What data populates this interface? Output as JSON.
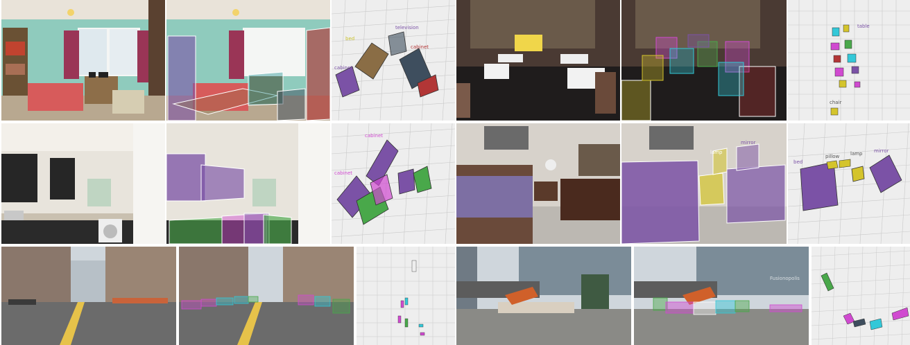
{
  "figure": {
    "rows": [
      {
        "scene": "bedroom",
        "panels": [
          "photo",
          "photo-with-3d-boxes",
          "birds-eye-view"
        ],
        "bev_labels": [
          "bed",
          "television",
          "cabinet",
          "cabinet",
          "cabinet"
        ]
      },
      {
        "scene": "restaurant",
        "panels": [
          "photo",
          "photo-with-3d-boxes",
          "birds-eye-view"
        ],
        "bev_labels": [
          "table",
          "chair",
          "chair"
        ]
      },
      {
        "scene": "kitchen",
        "panels": [
          "photo",
          "photo-with-3d-boxes",
          "birds-eye-view"
        ],
        "bev_labels": [
          "cabinet",
          "cabinet"
        ]
      },
      {
        "scene": "bedroom-showroom",
        "panels": [
          "photo",
          "photo-with-3d-boxes",
          "birds-eye-view"
        ],
        "bev_labels": [
          "bed",
          "lamp",
          "mirror",
          "pillow"
        ]
      },
      {
        "scene": "city-street",
        "panels": [
          "photo",
          "photo-with-3d-boxes",
          "birds-eye-view"
        ],
        "bev_labels": []
      },
      {
        "scene": "construction-site",
        "panels": [
          "photo",
          "photo-with-3d-boxes",
          "birds-eye-view"
        ],
        "bev_labels": []
      }
    ],
    "watermark": "Fusionopolis",
    "colors": {
      "purple": "#7b52a6",
      "brown": "#8a6d45",
      "teal": "#2e9a99",
      "darkslate": "#3e4e5e",
      "red": "#b23636",
      "green": "#49a84a",
      "magenta": "#d04ad0",
      "cyan": "#33c8d8",
      "yellow": "#d4c42c",
      "bev_bg": "#eeeeee",
      "grid": "#c9c9c9"
    }
  }
}
